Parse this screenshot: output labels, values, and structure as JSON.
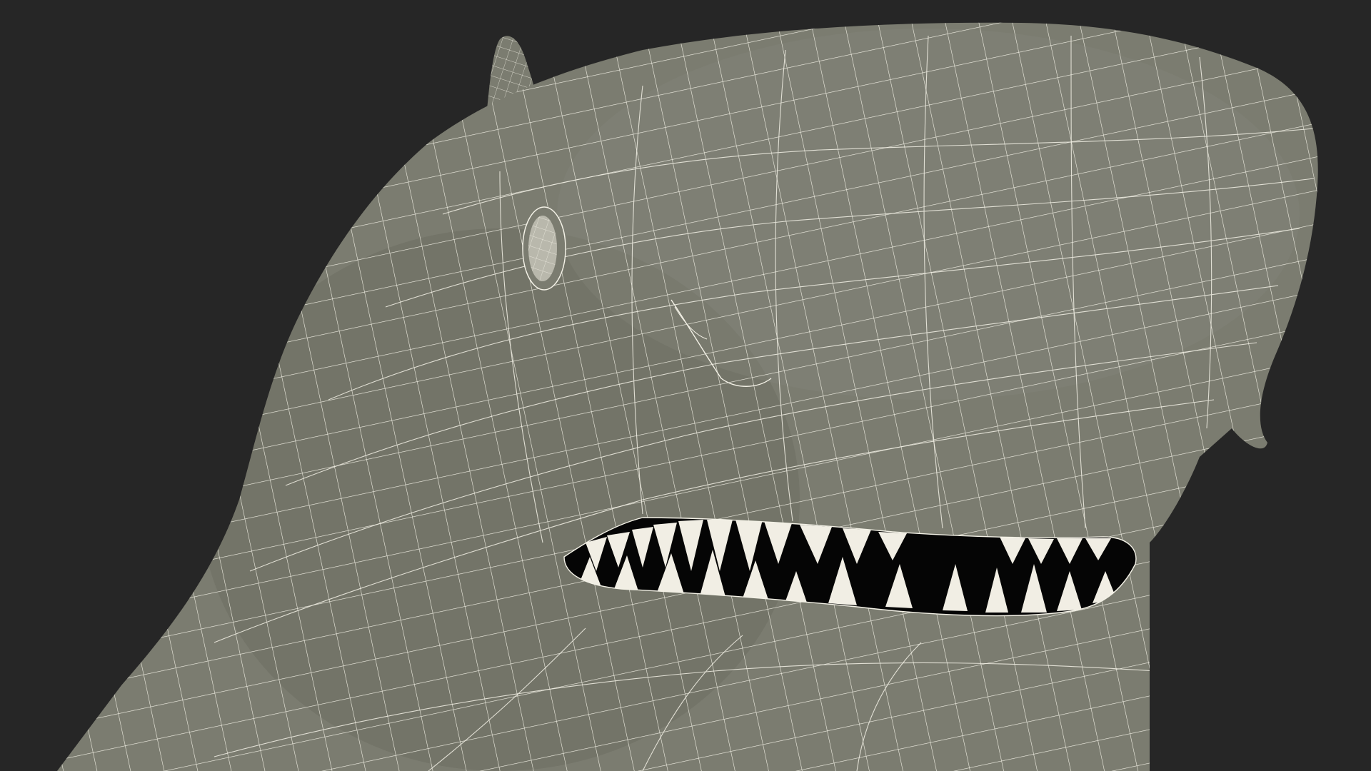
{
  "viewport": {
    "background_color": "#262626"
  },
  "model": {
    "subject": "shark-head",
    "render_mode": "wireframe-on-shaded",
    "skin_color": "#7b7c70",
    "skin_shadow_color": "#6a6b60",
    "wire_color": "#f3f1e6",
    "mouth_interior_color": "#050505",
    "teeth_color": "#f1eee4"
  }
}
